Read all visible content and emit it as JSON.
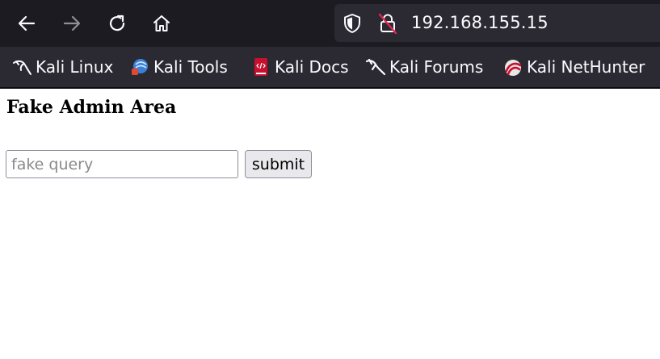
{
  "browser": {
    "url": "192.168.155.15",
    "bookmarks": [
      {
        "label": "Kali Linux",
        "icon": "kali-dragon-icon"
      },
      {
        "label": "Kali Tools",
        "icon": "kali-tools-icon"
      },
      {
        "label": "Kali Docs",
        "icon": "kali-docs-icon"
      },
      {
        "label": "Kali Forums",
        "icon": "kali-dragon-icon"
      },
      {
        "label": "Kali NetHunter",
        "icon": "kali-nethunter-icon"
      }
    ]
  },
  "page": {
    "heading": "Fake Admin Area",
    "query_placeholder": "fake query",
    "query_value": "",
    "submit_label": "submit"
  },
  "colors": {
    "toolbar_bg": "#1c1b22",
    "bookmarks_bg": "#2b2a33",
    "chrome_text": "#fbfbfe"
  }
}
